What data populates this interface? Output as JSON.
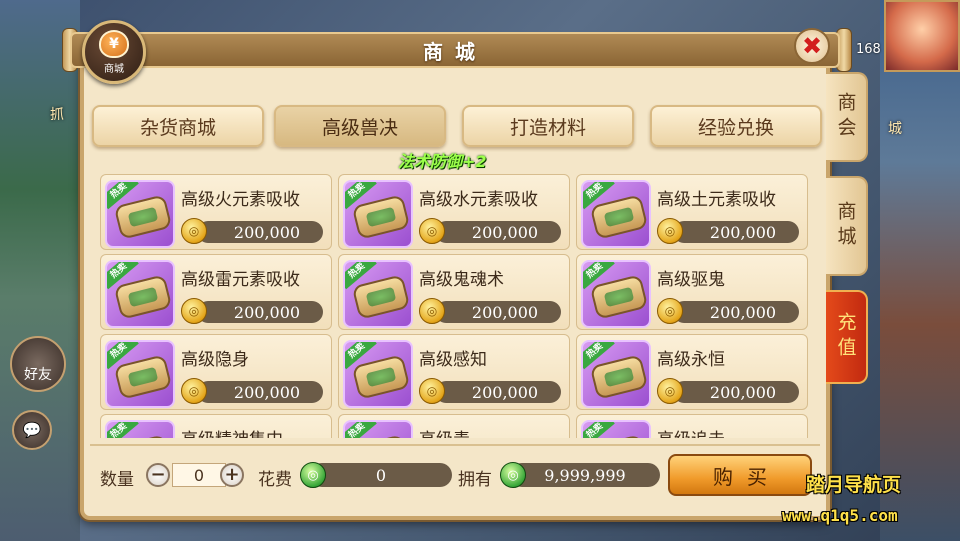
{
  "header": {
    "title": "商城",
    "badge_label": "商城",
    "badge_symbol": "¥",
    "close_symbol": "✖"
  },
  "tabs": [
    {
      "label": "杂货商城",
      "active": false
    },
    {
      "label": "高级兽决",
      "active": true
    },
    {
      "label": "打造材料",
      "active": false
    },
    {
      "label": "经验兑换",
      "active": false
    }
  ],
  "floating_text": "法术防御+2",
  "hot_tag": "热卖",
  "currency_symbol": "◎",
  "items": [
    {
      "name": "高级火元素吸收",
      "price": "200,000"
    },
    {
      "name": "高级水元素吸收",
      "price": "200,000"
    },
    {
      "name": "高级土元素吸收",
      "price": "200,000"
    },
    {
      "name": "高级雷元素吸收",
      "price": "200,000"
    },
    {
      "name": "高级鬼魂术",
      "price": "200,000"
    },
    {
      "name": "高级驱鬼",
      "price": "200,000"
    },
    {
      "name": "高级隐身",
      "price": "200,000"
    },
    {
      "name": "高级感知",
      "price": "200,000"
    },
    {
      "name": "高级永恒",
      "price": "200,000"
    },
    {
      "name": "高级精神集中",
      "price": ""
    },
    {
      "name": "高级毒",
      "price": ""
    },
    {
      "name": "高级追击",
      "price": ""
    }
  ],
  "bottom": {
    "quantity_label": "数量",
    "quantity_value": "0",
    "minus_symbol": "−",
    "plus_symbol": "+",
    "cost_label": "花费",
    "cost_value": "0",
    "own_label": "拥有",
    "own_value": "9,999,999",
    "buy_label": "购买"
  },
  "side_tabs": [
    {
      "label": "商会"
    },
    {
      "label": "商城"
    },
    {
      "label": "充值"
    }
  ],
  "background": {
    "friend_label": "好友",
    "right_text": "城",
    "left_text": "抓",
    "hud_number": "168"
  },
  "watermark": {
    "line1": "踏月导航页",
    "line2": "www.q1q5.com"
  },
  "colors": {
    "panel_bg": "#f4e6c8",
    "title_bar": "#8a6535",
    "price_bar": "#6b5b47",
    "hot_tag": "#3aa840",
    "buy_button": "#f09a2a",
    "recharge_tab": "#c22a10",
    "floating_text": "#9cff4a"
  }
}
